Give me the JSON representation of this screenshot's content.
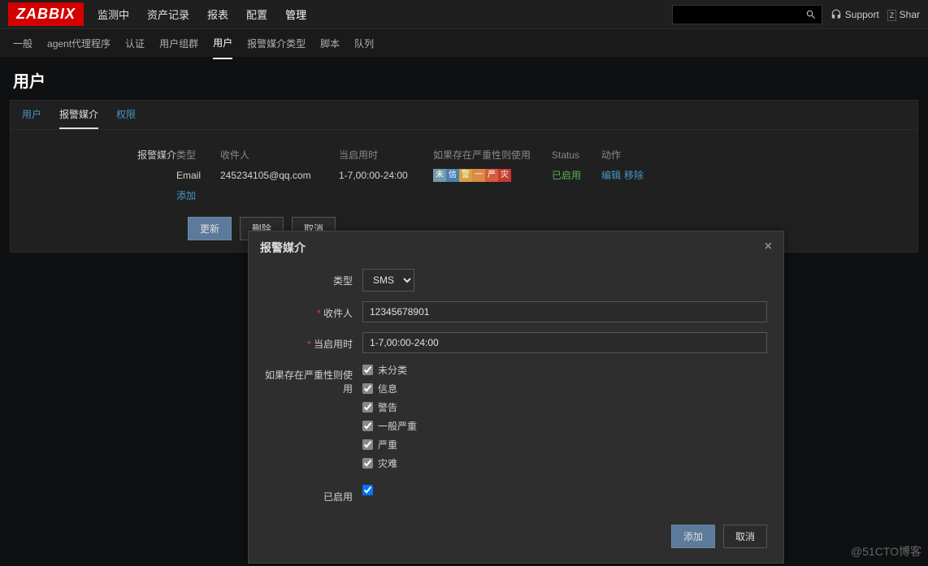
{
  "header": {
    "logo": "ZABBIX",
    "nav": [
      "监测中",
      "资产记录",
      "报表",
      "配置",
      "管理"
    ],
    "active_nav_index": 4,
    "support": "Support",
    "share": "Shar"
  },
  "subnav": {
    "items": [
      "一般",
      "agent代理程序",
      "认证",
      "用户组群",
      "用户",
      "报警媒介类型",
      "脚本",
      "队列"
    ],
    "active_index": 4
  },
  "page": {
    "title": "用户"
  },
  "tabs": {
    "items": [
      "用户",
      "报警媒介",
      "权限"
    ],
    "active_index": 1
  },
  "media_section": {
    "label": "报警媒介",
    "headers": {
      "type": "类型",
      "recipient": "收件人",
      "when_active": "当启用时",
      "severity": "如果存在严重性则使用",
      "status": "Status",
      "action": "动作"
    },
    "row": {
      "type": "Email",
      "recipient": "245234105@qq.com",
      "when_active": "1-7,00:00-24:00",
      "sev_badges": [
        "未",
        "信",
        "警",
        "一",
        "严",
        "灾"
      ],
      "status": "已启用",
      "edit": "编辑",
      "remove": "移除"
    },
    "add_link": "添加"
  },
  "buttons": {
    "update": "更新",
    "delete": "删除",
    "cancel": "取消"
  },
  "dialog": {
    "title": "报警媒介",
    "fields": {
      "type_label": "类型",
      "type_value": "SMS",
      "recipient_label": "收件人",
      "recipient_value": "12345678901",
      "when_active_label": "当启用时",
      "when_active_value": "1-7,00:00-24:00",
      "severity_label": "如果存在严重性则使用",
      "severity_options": [
        "未分类",
        "信息",
        "警告",
        "一般严重",
        "严重",
        "灾难"
      ],
      "enabled_label": "已启用"
    },
    "footer": {
      "add": "添加",
      "cancel": "取消"
    }
  },
  "watermark": "@51CTO博客"
}
